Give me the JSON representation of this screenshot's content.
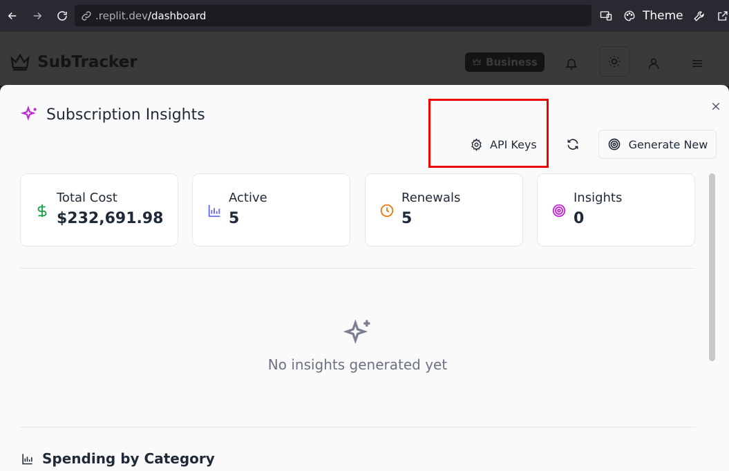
{
  "browser": {
    "url_host": ".replit.dev",
    "url_path": "/dashboard",
    "theme_label": "Theme"
  },
  "app": {
    "logo_text": "SubTracker",
    "plan_badge": "Business"
  },
  "modal": {
    "title": "Subscription Insights",
    "api_keys_label": "API Keys",
    "generate_label": "Generate New",
    "stats": [
      {
        "label": "Total Cost",
        "value": "$232,691.98",
        "icon": "dollar-icon",
        "color": "#16a34a"
      },
      {
        "label": "Active",
        "value": "5",
        "icon": "bar-chart-icon",
        "color": "#6366f1"
      },
      {
        "label": "Renewals",
        "value": "5",
        "icon": "clock-icon",
        "color": "#ea7a0c"
      },
      {
        "label": "Insights",
        "value": "0",
        "icon": "target-icon",
        "color": "#c026d3"
      }
    ],
    "empty_text": "No insights generated yet",
    "section_title": "Spending by Category"
  },
  "colors": {
    "accent_purple": "#c026d3",
    "highlight": "#ee0000"
  }
}
